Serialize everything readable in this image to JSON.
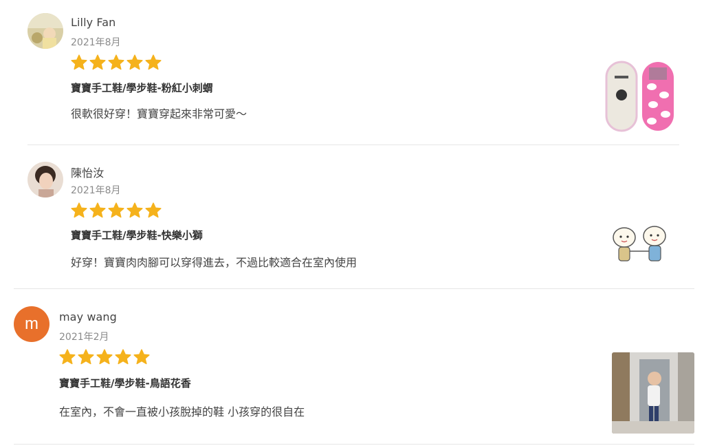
{
  "reviews": [
    {
      "name": "Lilly Fan",
      "date": "2021年8月",
      "rating": 5,
      "product": "寶寶手工鞋/學步鞋-粉紅小刺蝟",
      "comment": "很軟很好穿！寶寶穿起來非常可愛～",
      "avatar": "photo",
      "thumbnail": "pink-shoes-image"
    },
    {
      "name": "陳怡汝",
      "date": "2021年8月",
      "rating": 5,
      "product": "寶寶手工鞋/學步鞋-快樂小獅",
      "comment": "好穿！寶寶肉肉腳可以穿得進去，不過比較適合在室內使用",
      "avatar": "photo",
      "thumbnail": "lion-cartoon-image"
    },
    {
      "name": "may wang",
      "date": "2021年2月",
      "rating": 5,
      "product": "寶寶手工鞋/學步鞋-鳥語花香",
      "comment": "在室內，不會一直被小孩脫掉的鞋 小孩穿的很自在",
      "avatar": "letter",
      "avatar_letter": "m",
      "avatar_color": "#e8702b",
      "thumbnail": "child-photo-image"
    }
  ],
  "colors": {
    "star": "#f5b21c",
    "divider": "#e6e6e6"
  }
}
